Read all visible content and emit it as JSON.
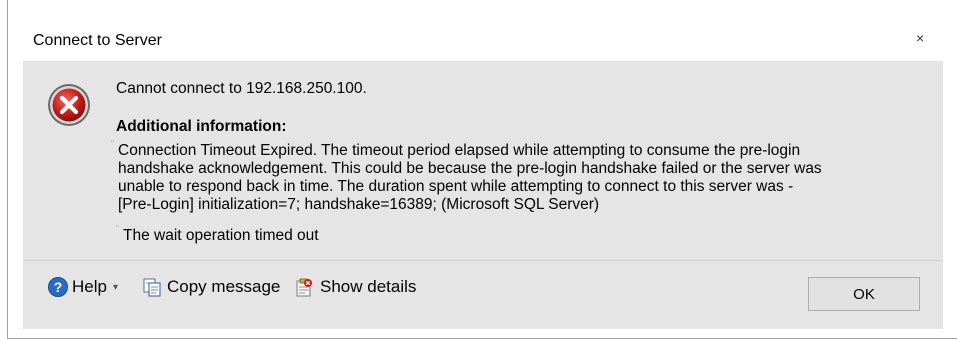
{
  "window": {
    "title": "Connect to Server",
    "close_glyph": "×"
  },
  "message": {
    "main": "Cannot connect to 192.168.250.100.",
    "additional_heading": "Additional information:",
    "details": "Connection Timeout Expired.  The timeout period elapsed while attempting to consume the pre-login\nhandshake acknowledgement.  This could be because the pre-login handshake failed or the server was\nunable to respond back in time.  The duration spent while attempting to connect to this server was -\n[Pre-Login] initialization=7; handshake=16389;  (Microsoft SQL Server)",
    "inner_details": "The wait operation timed out"
  },
  "footer": {
    "help_label": "Help",
    "help_dropdown_glyph": "▾",
    "copy_label": "Copy message",
    "details_label": "Show details",
    "ok_label": "OK"
  },
  "icons": {
    "error": "error-icon",
    "help": "help-icon",
    "copy": "copy-icon",
    "details": "show-details-icon"
  },
  "colors": {
    "dialog_background": "#e5e5e5",
    "error_red": "#c7201d",
    "help_blue": "#2a6cc4"
  }
}
